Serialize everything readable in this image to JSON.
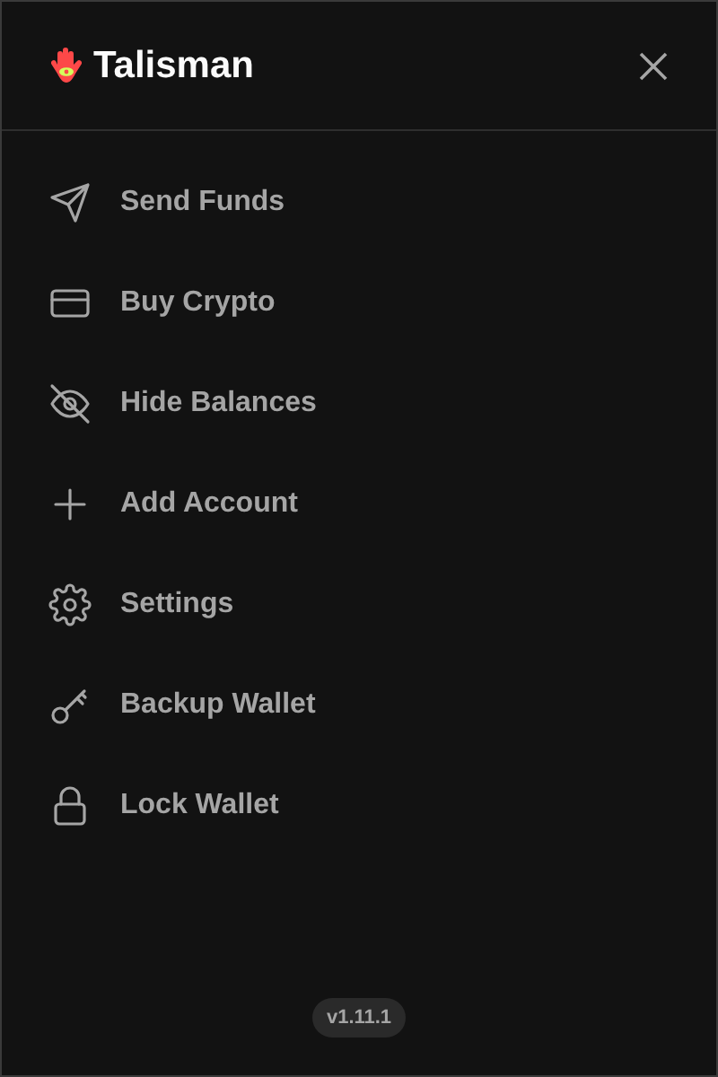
{
  "header": {
    "brand": "Talisman"
  },
  "menu": [
    {
      "kind": "send",
      "label": "Send Funds"
    },
    {
      "kind": "card",
      "label": "Buy Crypto"
    },
    {
      "kind": "eye-off",
      "label": "Hide Balances"
    },
    {
      "kind": "plus",
      "label": "Add Account"
    },
    {
      "kind": "gear",
      "label": "Settings"
    },
    {
      "kind": "key",
      "label": "Backup Wallet"
    },
    {
      "kind": "lock",
      "label": "Lock Wallet"
    }
  ],
  "version": "v1.11.1"
}
